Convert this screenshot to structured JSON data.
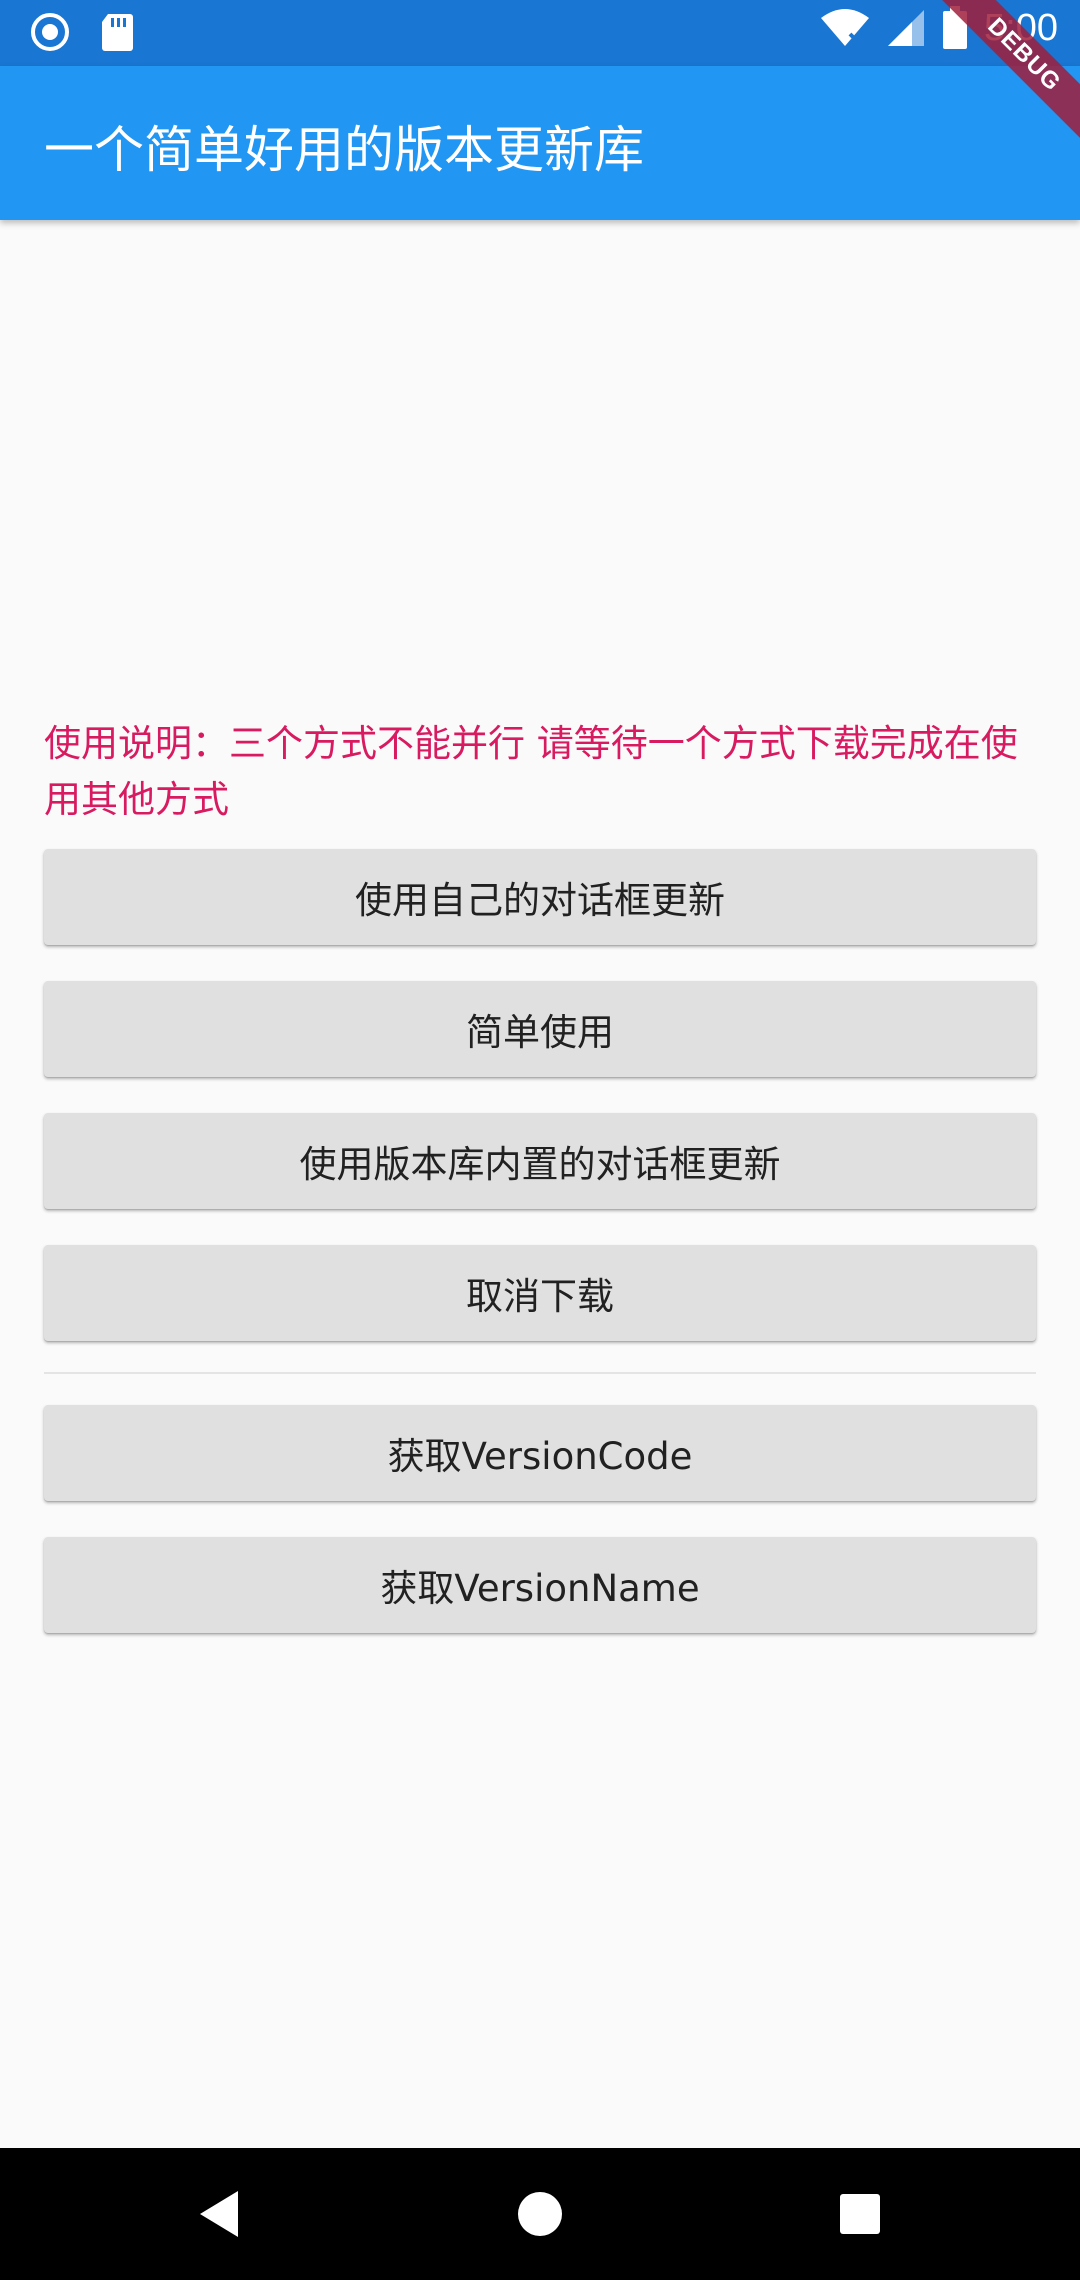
{
  "status_bar": {
    "time": "5:00",
    "left_icons": [
      "record-icon",
      "sd-card-icon"
    ],
    "right_icons": [
      "wifi-icon",
      "signal-icon",
      "battery-icon"
    ]
  },
  "debug_banner": "DEBUG",
  "app_bar": {
    "title": "一个简单好用的版本更新库"
  },
  "notice": "使用说明：三个方式不能并行 请等待一个方式下载完成在使用其他方式",
  "buttons": {
    "own_dialog": "使用自己的对话框更新",
    "simple_use": "简单使用",
    "builtin_dialog": "使用版本库内置的对话框更新",
    "cancel_download": "取消下载",
    "get_version_code": "获取VersionCode",
    "get_version_name": "获取VersionName"
  },
  "nav_bar": {
    "icons": [
      "back-icon",
      "home-icon",
      "recents-icon"
    ]
  },
  "colors": {
    "status_bar": "#1976d2",
    "app_bar": "#2196f3",
    "notice_text": "#d81b60",
    "button_bg": "#e0e0e0",
    "background": "#fafafa"
  }
}
